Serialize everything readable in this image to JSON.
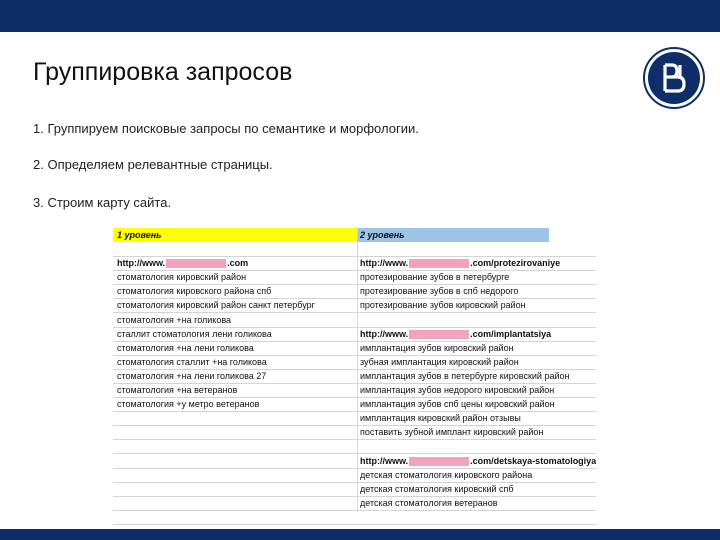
{
  "slide": {
    "title": "Группировка запросов",
    "steps": [
      "1. Группируем поисковые запросы по семантике и морфологии.",
      "2. Определяем релевантные страницы.",
      "3. Строим карту сайта."
    ]
  },
  "colors": {
    "bar": "#0f2d69",
    "header_level1": "#ffff00",
    "header_level2": "#9dc3e6",
    "mask": "#f2a2bd"
  },
  "table": {
    "header": {
      "col1": "1 уровень",
      "col2": "2 уровень"
    },
    "rows": [
      {
        "col1": "",
        "col2": ""
      },
      {
        "col1_pre": "http://www.",
        "col1_post": ".com",
        "col2_pre": "http://www.",
        "col2_post": ".com/protezirovaniye"
      },
      {
        "col1": "стоматология кировский район",
        "col2": "протезирование зубов в петербурге"
      },
      {
        "col1": "стоматология кировского района спб",
        "col2": "протезирование зубов в спб недорого"
      },
      {
        "col1": "стоматология кировский район санкт петербург",
        "col2": "протезирование зубов кировский район"
      },
      {
        "col1": "стоматология +на голикова",
        "col2": ""
      },
      {
        "col1": "сталлит стоматология лени голикова",
        "col2_pre": "http://www.",
        "col2_post": ".com/implantatsiya"
      },
      {
        "col1": "стоматология +на лени голикова",
        "col2": "имплантация зубов кировский район"
      },
      {
        "col1": "стоматология сталлит +на голикова",
        "col2": "зубная имплантация кировский район"
      },
      {
        "col1": "стоматология +на лени голикова 27",
        "col2": "имплантация зубов в петербурге кировский район"
      },
      {
        "col1": "стоматология +на ветеранов",
        "col2": "имплантация зубов недорого кировский район"
      },
      {
        "col1": "стоматология +у метро ветеранов",
        "col2": "имплантация зубов спб цены кировский район"
      },
      {
        "col1": "",
        "col2": "имплантация кировский район отзывы"
      },
      {
        "col1": "",
        "col2": "поставить зубной имплант кировский район"
      },
      {
        "col1": "",
        "col2": ""
      },
      {
        "col1": "",
        "col2_pre": "http://www.",
        "col2_post": ".com/detskaya-stomatologiya"
      },
      {
        "col1": "",
        "col2": "детская стоматология кировского района"
      },
      {
        "col1": "",
        "col2": "детская стоматология кировский спб"
      },
      {
        "col1": "",
        "col2": "детская стоматология ветеранов"
      },
      {
        "col1": "",
        "col2": ""
      }
    ]
  }
}
